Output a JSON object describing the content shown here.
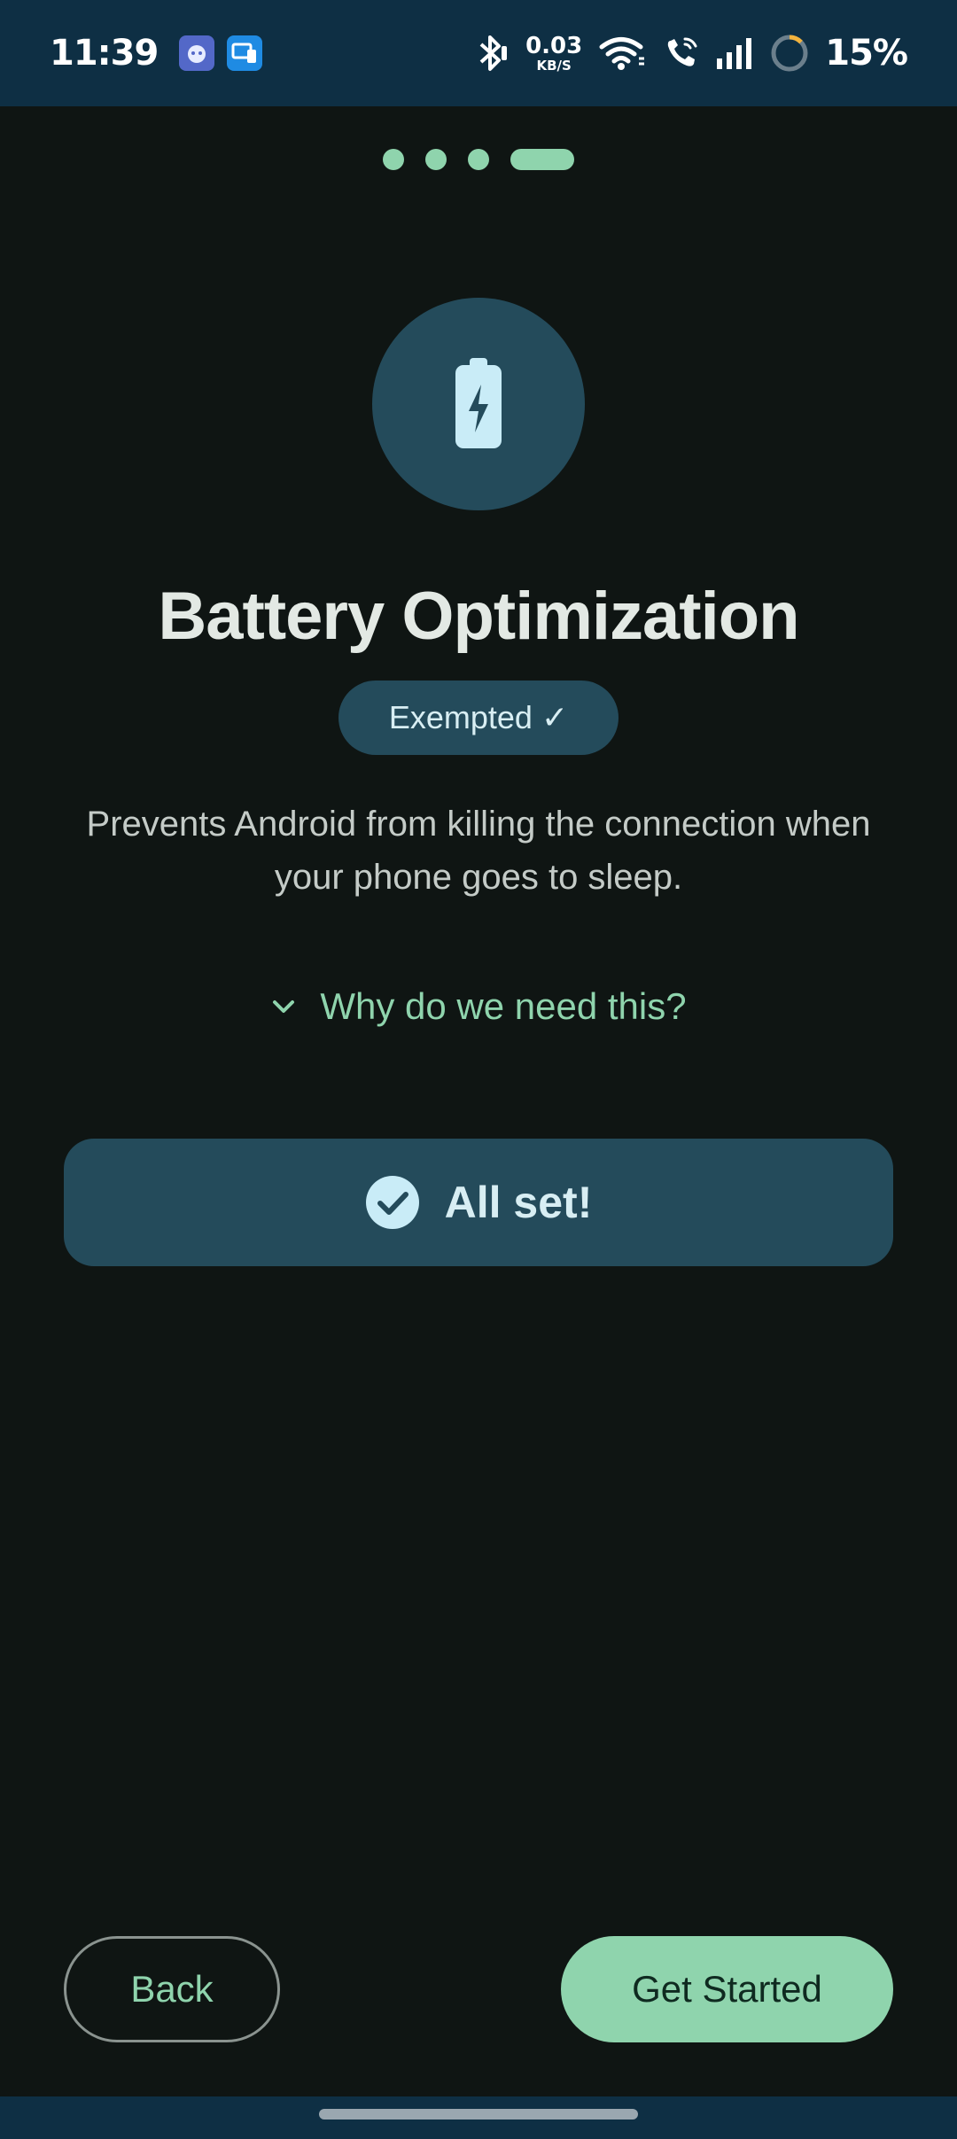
{
  "status_bar": {
    "time": "11:39",
    "net_speed_value": "0.03",
    "net_speed_unit": "KB/S",
    "battery_percent": "15%",
    "icons": [
      "app-notification-icon",
      "device-notification-icon",
      "bluetooth-icon",
      "wifi-icon",
      "wifi-call-icon",
      "signal-icon",
      "battery-ring-icon"
    ]
  },
  "progress": {
    "total_steps": 4,
    "current_step": 4
  },
  "hero": {
    "icon": "battery-charging-icon"
  },
  "title": "Battery Optimization",
  "status_chip": "Exempted ✓",
  "description": "Prevents Android from killing the connection when your phone goes to sleep.",
  "expander": {
    "icon": "chevron-down-icon",
    "label": "Why do we need this?"
  },
  "primary_card": {
    "icon": "check-circle-icon",
    "label": "All set!"
  },
  "footer": {
    "back_label": "Back",
    "next_label": "Get Started"
  },
  "colors": {
    "background": "#0f1513",
    "status_bar": "#0e2f44",
    "accent": "#8fd4ad",
    "card": "#244b5b",
    "title_text": "#e3e9e4",
    "chip_text": "#d8eef3"
  }
}
